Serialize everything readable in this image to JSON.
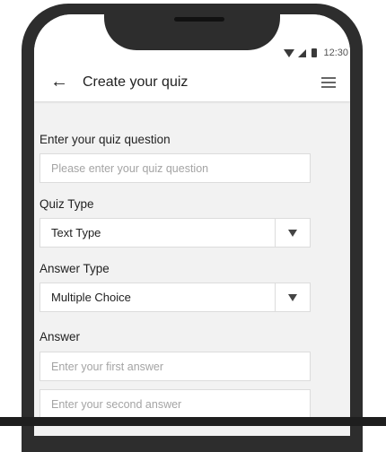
{
  "status_bar": {
    "time": "12:30"
  },
  "header": {
    "title": "Create your quiz",
    "back_icon": "arrow-left-icon",
    "menu_icon": "list-icon"
  },
  "form": {
    "question": {
      "label": "Enter your quiz question",
      "placeholder": "Please enter your quiz question",
      "value": ""
    },
    "quiz_type": {
      "label": "Quiz Type",
      "selected": "Text Type"
    },
    "answer_type": {
      "label": "Answer Type",
      "selected": "Multiple Choice"
    },
    "answer": {
      "label": "Answer",
      "first_placeholder": "Enter your first answer",
      "second_placeholder": "Enter your second answer"
    }
  },
  "colors": {
    "device_frame": "#2d2d2d",
    "screen_background": "#f2f2f2",
    "appbar_background": "#ffffff",
    "field_border": "#dcdcdc"
  }
}
